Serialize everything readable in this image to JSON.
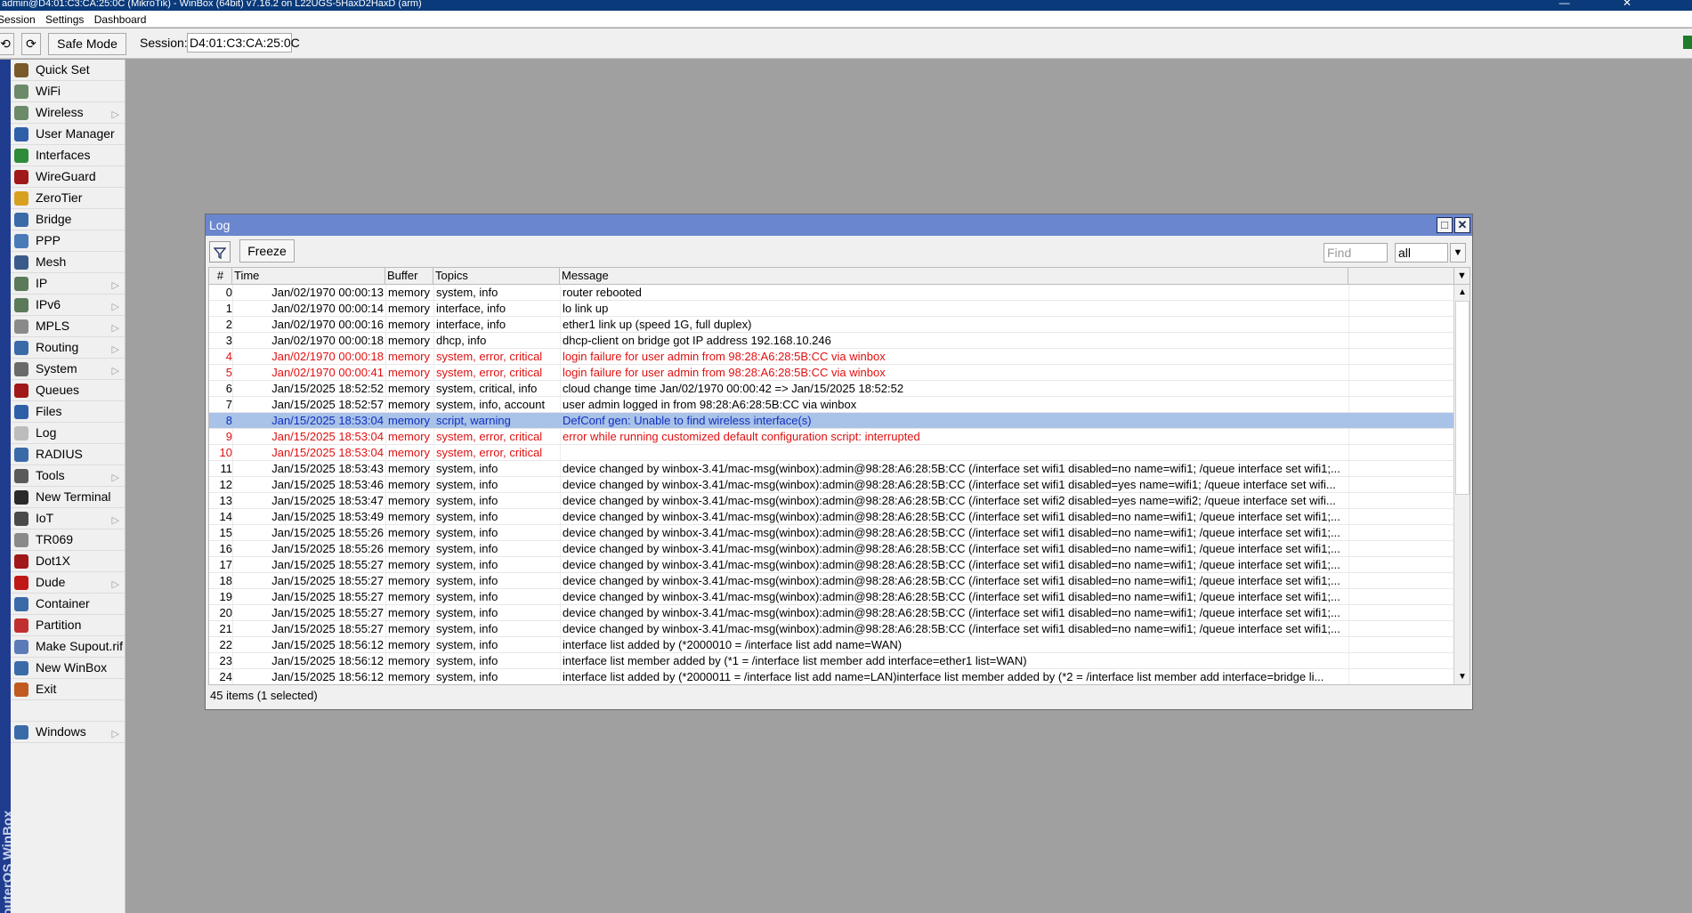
{
  "window": {
    "title": "admin@D4:01:C3:CA:25:0C (MikroTik) - WinBox (64bit) v7.16.2 on L22UGS-5HaxD2HaxD (arm)"
  },
  "menubar": [
    "Session",
    "Settings",
    "Dashboard"
  ],
  "toolbar": {
    "undo_icon": "undo-icon",
    "redo_icon": "redo-icon",
    "safe_mode_label": "Safe Mode",
    "session_label": "Session:",
    "session_value": "D4:01:C3:CA:25:0C"
  },
  "sidebar": {
    "vertical_label": "RouterOS WinBox",
    "items": [
      {
        "label": "Quick Set",
        "icon": "wand-icon",
        "color": "#7a5a2a",
        "submenu": false
      },
      {
        "label": "WiFi",
        "icon": "antenna-icon",
        "color": "#6a8a6a",
        "submenu": false
      },
      {
        "label": "Wireless",
        "icon": "antenna-icon",
        "color": "#6a8a6a",
        "submenu": true
      },
      {
        "label": "User Manager",
        "icon": "users-icon",
        "color": "#2f5fa8",
        "submenu": false
      },
      {
        "label": "Interfaces",
        "icon": "interfaces-icon",
        "color": "#2e8b3a",
        "submenu": false
      },
      {
        "label": "WireGuard",
        "icon": "wireguard-icon",
        "color": "#a01818",
        "submenu": false
      },
      {
        "label": "ZeroTier",
        "icon": "zerotier-icon",
        "color": "#d8a020",
        "submenu": false
      },
      {
        "label": "Bridge",
        "icon": "bridge-icon",
        "color": "#3a6aa8",
        "submenu": false
      },
      {
        "label": "PPP",
        "icon": "ppp-icon",
        "color": "#4a7ab8",
        "submenu": false
      },
      {
        "label": "Mesh",
        "icon": "mesh-icon",
        "color": "#3a5a8a",
        "submenu": false
      },
      {
        "label": "IP",
        "icon": "ip-icon",
        "color": "#5a7a5a",
        "submenu": true
      },
      {
        "label": "IPv6",
        "icon": "ipv6-icon",
        "color": "#5a7a5a",
        "submenu": true
      },
      {
        "label": "MPLS",
        "icon": "mpls-icon",
        "color": "#8a8a8a",
        "submenu": true
      },
      {
        "label": "Routing",
        "icon": "routing-icon",
        "color": "#3a6aa8",
        "submenu": true
      },
      {
        "label": "System",
        "icon": "gear-icon",
        "color": "#6a6a6a",
        "submenu": true
      },
      {
        "label": "Queues",
        "icon": "queues-icon",
        "color": "#a01818",
        "submenu": false
      },
      {
        "label": "Files",
        "icon": "folder-icon",
        "color": "#2f5fa8",
        "submenu": false
      },
      {
        "label": "Log",
        "icon": "log-icon",
        "color": "#bcbcbc",
        "submenu": false
      },
      {
        "label": "RADIUS",
        "icon": "radius-icon",
        "color": "#3a6aa8",
        "submenu": false
      },
      {
        "label": "Tools",
        "icon": "tools-icon",
        "color": "#5a5a5a",
        "submenu": true
      },
      {
        "label": "New Terminal",
        "icon": "terminal-icon",
        "color": "#2a2a2a",
        "submenu": false
      },
      {
        "label": "IoT",
        "icon": "iot-icon",
        "color": "#4a4a4a",
        "submenu": true
      },
      {
        "label": "TR069",
        "icon": "tr069-icon",
        "color": "#8a8a8a",
        "submenu": false
      },
      {
        "label": "Dot1X",
        "icon": "dot1x-icon",
        "color": "#a01818",
        "submenu": false
      },
      {
        "label": "Dude",
        "icon": "dude-icon",
        "color": "#c01818",
        "submenu": true
      },
      {
        "label": "Container",
        "icon": "container-icon",
        "color": "#3a6aa8",
        "submenu": false
      },
      {
        "label": "Partition",
        "icon": "partition-icon",
        "color": "#c03030",
        "submenu": false
      },
      {
        "label": "Make Supout.rif",
        "icon": "supout-icon",
        "color": "#5a7ab8",
        "submenu": false
      },
      {
        "label": "New WinBox",
        "icon": "winbox-icon",
        "color": "#3a6aa8",
        "submenu": false
      },
      {
        "label": "Exit",
        "icon": "exit-icon",
        "color": "#c05a20",
        "submenu": false
      }
    ],
    "windows_item": {
      "label": "Windows",
      "icon": "windows-icon",
      "color": "#3a6aa8",
      "submenu": true
    }
  },
  "log_window": {
    "title": "Log",
    "freeze_label": "Freeze",
    "find_placeholder": "Find",
    "filter_value": "all",
    "columns": [
      "#",
      "Time",
      "Buffer",
      "Topics",
      "Message"
    ],
    "rows": [
      {
        "num": "0",
        "time": "Jan/02/1970 00:00:13",
        "buffer": "memory",
        "topics": "system, info",
        "message": "router rebooted",
        "style": "normal"
      },
      {
        "num": "1",
        "time": "Jan/02/1970 00:00:14",
        "buffer": "memory",
        "topics": "interface, info",
        "message": "lo link up",
        "style": "normal"
      },
      {
        "num": "2",
        "time": "Jan/02/1970 00:00:16",
        "buffer": "memory",
        "topics": "interface, info",
        "message": "ether1 link up (speed 1G, full duplex)",
        "style": "normal"
      },
      {
        "num": "3",
        "time": "Jan/02/1970 00:00:18",
        "buffer": "memory",
        "topics": "dhcp, info",
        "message": "dhcp-client on bridge got IP address 192.168.10.246",
        "style": "normal"
      },
      {
        "num": "4",
        "time": "Jan/02/1970 00:00:18",
        "buffer": "memory",
        "topics": "system, error, critical",
        "message": "login failure for user admin from 98:28:A6:28:5B:CC via winbox",
        "style": "red"
      },
      {
        "num": "5",
        "time": "Jan/02/1970 00:00:41",
        "buffer": "memory",
        "topics": "system, error, critical",
        "message": "login failure for user admin from 98:28:A6:28:5B:CC via winbox",
        "style": "red"
      },
      {
        "num": "6",
        "time": "Jan/15/2025 18:52:52",
        "buffer": "memory",
        "topics": "system, critical, info",
        "message": "cloud change time Jan/02/1970 00:00:42 => Jan/15/2025 18:52:52",
        "style": "normal"
      },
      {
        "num": "7",
        "time": "Jan/15/2025 18:52:57",
        "buffer": "memory",
        "topics": "system, info, account",
        "message": "user admin logged in from 98:28:A6:28:5B:CC via winbox",
        "style": "normal"
      },
      {
        "num": "8",
        "time": "Jan/15/2025 18:53:04",
        "buffer": "memory",
        "topics": "script, warning",
        "message": "DefConf gen: Unable to find wireless interface(s)",
        "style": "sel"
      },
      {
        "num": "9",
        "time": "Jan/15/2025 18:53:04",
        "buffer": "memory",
        "topics": "system, error, critical",
        "message": "error while running customized default configuration script: interrupted",
        "style": "red"
      },
      {
        "num": "10",
        "time": "Jan/15/2025 18:53:04",
        "buffer": "memory",
        "topics": "system, error, critical",
        "message": "",
        "style": "red"
      },
      {
        "num": "11",
        "time": "Jan/15/2025 18:53:43",
        "buffer": "memory",
        "topics": "system, info",
        "message": "device changed by winbox-3.41/mac-msg(winbox):admin@98:28:A6:28:5B:CC (/interface set wifi1 disabled=no name=wifi1; /queue interface set wifi1;...",
        "style": "normal"
      },
      {
        "num": "12",
        "time": "Jan/15/2025 18:53:46",
        "buffer": "memory",
        "topics": "system, info",
        "message": "device changed by winbox-3.41/mac-msg(winbox):admin@98:28:A6:28:5B:CC (/interface set wifi1 disabled=yes name=wifi1; /queue interface set wifi...",
        "style": "normal"
      },
      {
        "num": "13",
        "time": "Jan/15/2025 18:53:47",
        "buffer": "memory",
        "topics": "system, info",
        "message": "device changed by winbox-3.41/mac-msg(winbox):admin@98:28:A6:28:5B:CC (/interface set wifi2 disabled=yes name=wifi2; /queue interface set wifi...",
        "style": "normal"
      },
      {
        "num": "14",
        "time": "Jan/15/2025 18:53:49",
        "buffer": "memory",
        "topics": "system, info",
        "message": "device changed by winbox-3.41/mac-msg(winbox):admin@98:28:A6:28:5B:CC (/interface set wifi1 disabled=no name=wifi1; /queue interface set wifi1;...",
        "style": "normal"
      },
      {
        "num": "15",
        "time": "Jan/15/2025 18:55:26",
        "buffer": "memory",
        "topics": "system, info",
        "message": "device changed by winbox-3.41/mac-msg(winbox):admin@98:28:A6:28:5B:CC (/interface set wifi1 disabled=no name=wifi1; /queue interface set wifi1;...",
        "style": "normal"
      },
      {
        "num": "16",
        "time": "Jan/15/2025 18:55:26",
        "buffer": "memory",
        "topics": "system, info",
        "message": "device changed by winbox-3.41/mac-msg(winbox):admin@98:28:A6:28:5B:CC (/interface set wifi1 disabled=no name=wifi1; /queue interface set wifi1;...",
        "style": "normal"
      },
      {
        "num": "17",
        "time": "Jan/15/2025 18:55:27",
        "buffer": "memory",
        "topics": "system, info",
        "message": "device changed by winbox-3.41/mac-msg(winbox):admin@98:28:A6:28:5B:CC (/interface set wifi1 disabled=no name=wifi1; /queue interface set wifi1;...",
        "style": "normal"
      },
      {
        "num": "18",
        "time": "Jan/15/2025 18:55:27",
        "buffer": "memory",
        "topics": "system, info",
        "message": "device changed by winbox-3.41/mac-msg(winbox):admin@98:28:A6:28:5B:CC (/interface set wifi1 disabled=no name=wifi1; /queue interface set wifi1;...",
        "style": "normal"
      },
      {
        "num": "19",
        "time": "Jan/15/2025 18:55:27",
        "buffer": "memory",
        "topics": "system, info",
        "message": "device changed by winbox-3.41/mac-msg(winbox):admin@98:28:A6:28:5B:CC (/interface set wifi1 disabled=no name=wifi1; /queue interface set wifi1;...",
        "style": "normal"
      },
      {
        "num": "20",
        "time": "Jan/15/2025 18:55:27",
        "buffer": "memory",
        "topics": "system, info",
        "message": "device changed by winbox-3.41/mac-msg(winbox):admin@98:28:A6:28:5B:CC (/interface set wifi1 disabled=no name=wifi1; /queue interface set wifi1;...",
        "style": "normal"
      },
      {
        "num": "21",
        "time": "Jan/15/2025 18:55:27",
        "buffer": "memory",
        "topics": "system, info",
        "message": "device changed by winbox-3.41/mac-msg(winbox):admin@98:28:A6:28:5B:CC (/interface set wifi1 disabled=no name=wifi1; /queue interface set wifi1;...",
        "style": "normal"
      },
      {
        "num": "22",
        "time": "Jan/15/2025 18:56:12",
        "buffer": "memory",
        "topics": "system, info",
        "message": "interface list added by  (*2000010 = /interface list add name=WAN)",
        "style": "normal"
      },
      {
        "num": "23",
        "time": "Jan/15/2025 18:56:12",
        "buffer": "memory",
        "topics": "system, info",
        "message": "interface list member added by  (*1 = /interface list member add interface=ether1 list=WAN)",
        "style": "normal"
      },
      {
        "num": "24",
        "time": "Jan/15/2025 18:56:12",
        "buffer": "memory",
        "topics": "system, info",
        "message": "interface list added by  (*2000011 = /interface list add name=LAN)interface list member added by  (*2 = /interface list member add interface=bridge li...",
        "style": "normal"
      }
    ],
    "status": "45 items (1 selected)"
  }
}
